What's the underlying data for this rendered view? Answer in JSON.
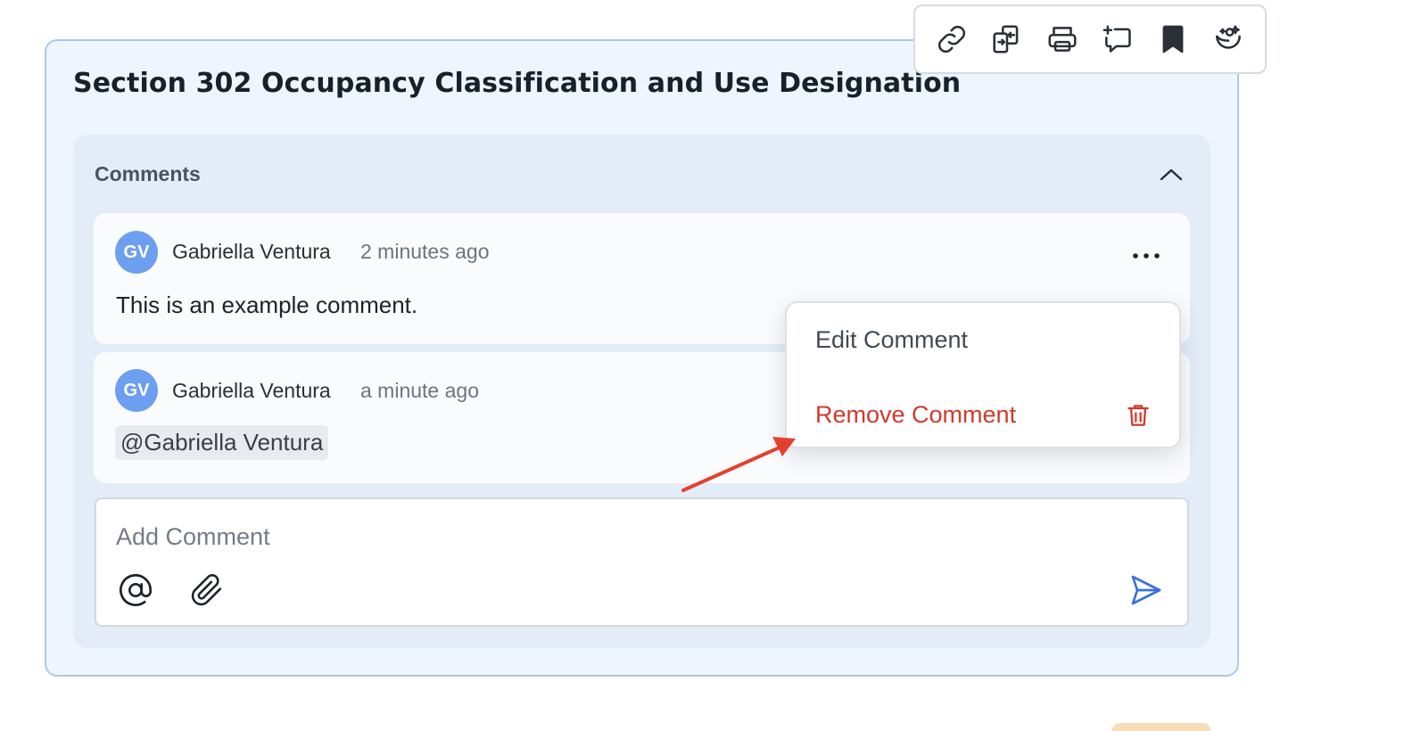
{
  "section": {
    "title": "Section 302 Occupancy Classification and Use Designation"
  },
  "toolbar": {
    "icons": [
      "link-icon",
      "compare-icon",
      "print-icon",
      "add-note-icon",
      "bookmark-icon",
      "ai-assist-icon"
    ]
  },
  "comments": {
    "label": "Comments",
    "items": [
      {
        "initials": "GV",
        "author": "Gabriella Ventura",
        "time": "2 minutes ago",
        "body": "This is an example comment."
      },
      {
        "initials": "GV",
        "author": "Gabriella Ventura",
        "time": "a minute ago",
        "mention": "@Gabriella Ventura"
      }
    ]
  },
  "add_comment": {
    "placeholder": "Add Comment"
  },
  "menu": {
    "edit_label": "Edit Comment",
    "remove_label": "Remove Comment"
  },
  "colors": {
    "accent_blue": "#3b6fe0",
    "danger_red": "#d2392b",
    "avatar_blue": "#6d9ff0",
    "annotation_arrow": "#e2412e"
  }
}
